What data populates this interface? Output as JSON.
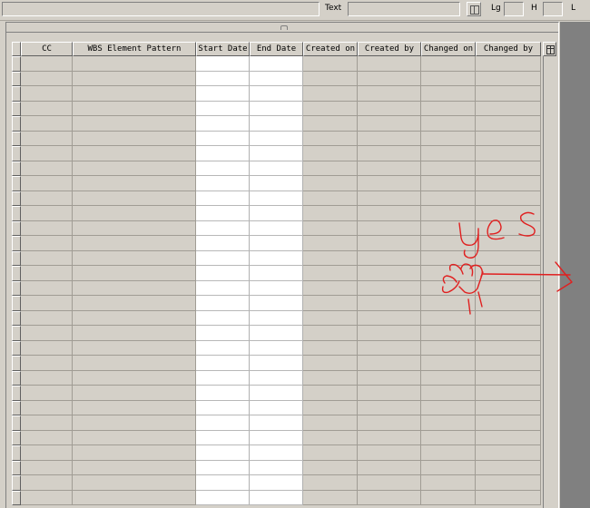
{
  "toolbar": {
    "text_label": "Text",
    "lg_label": "Lg",
    "h_label": "H",
    "l_label": "L",
    "text_value": "",
    "lg_value": "",
    "h_value": ""
  },
  "table": {
    "columns": [
      "CC",
      "WBS Element Pattern",
      "Start Date",
      "End Date",
      "Created on",
      "Created by",
      "Changed on",
      "Changed by"
    ],
    "editable_columns": [
      "Start Date",
      "End Date"
    ],
    "row_count": 30
  },
  "annotation": {
    "handwritten_text": "yes",
    "color": "#e02020",
    "icon": "hand-pointing-arrow-icon"
  },
  "colors": {
    "background": "#d4d0c8",
    "editable_cell": "#ffffff",
    "panel_right": "#808080"
  }
}
